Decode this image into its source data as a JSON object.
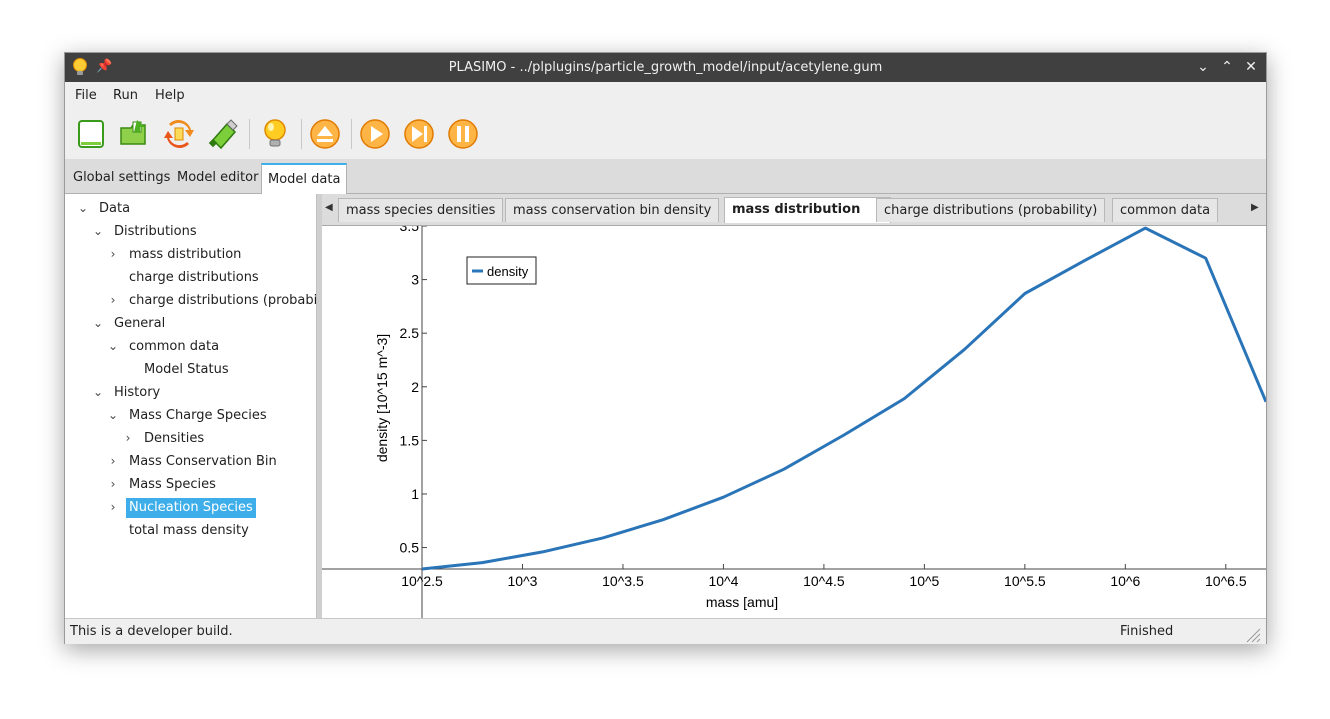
{
  "window": {
    "title": "PLASIMO - ../plplugins/particle_growth_model/input/acetylene.gum",
    "buttons": [
      "minimize",
      "maximize",
      "close"
    ]
  },
  "menu": {
    "items": [
      "File",
      "Run",
      "Help"
    ]
  },
  "toolbar": {
    "icons": [
      "new-file-icon",
      "open-folder-icon",
      "reload-icon",
      "usb-drive-icon",
      "lightbulb-icon",
      "eject-icon",
      "play-icon",
      "step-icon",
      "pause-icon"
    ]
  },
  "main_tabs": [
    "Global settings",
    "Model editor",
    "Model data"
  ],
  "main_tab_active": "Model data",
  "tree": {
    "nodes": [
      {
        "label": "Data",
        "level": 0,
        "expander": "open"
      },
      {
        "label": "Distributions",
        "level": 1,
        "expander": "open"
      },
      {
        "label": "mass distribution",
        "level": 2,
        "expander": "closed"
      },
      {
        "label": "charge distributions",
        "level": 2,
        "expander": "none"
      },
      {
        "label": "charge distributions (probabilit",
        "level": 2,
        "expander": "closed"
      },
      {
        "label": "General",
        "level": 1,
        "expander": "open"
      },
      {
        "label": "common data",
        "level": 2,
        "expander": "open"
      },
      {
        "label": "Model Status",
        "level": 3,
        "expander": "none"
      },
      {
        "label": "History",
        "level": 1,
        "expander": "open"
      },
      {
        "label": "Mass Charge Species",
        "level": 2,
        "expander": "open"
      },
      {
        "label": "Densities",
        "level": 3,
        "expander": "closed"
      },
      {
        "label": "Mass Conservation Bin",
        "level": 2,
        "expander": "closed"
      },
      {
        "label": "Mass Species",
        "level": 2,
        "expander": "closed"
      },
      {
        "label": "Nucleation Species",
        "level": 2,
        "expander": "closed",
        "selected": true
      },
      {
        "label": "total mass density",
        "level": 2,
        "expander": "none"
      }
    ]
  },
  "data_tabs": [
    {
      "label": "mass species densities"
    },
    {
      "label": "mass conservation bin density"
    },
    {
      "label": "mass distribution",
      "active": true,
      "closable": true
    },
    {
      "label": "charge distributions (probability)"
    },
    {
      "label": "common data"
    }
  ],
  "chart_data": {
    "type": "line",
    "xlabel": "mass [amu]",
    "ylabel": "density [10^15 m^-3]",
    "x_tick_labels": [
      "10^2.5",
      "10^3",
      "10^3.5",
      "10^4",
      "10^4.5",
      "10^5",
      "10^5.5",
      "10^6",
      "10^6.5"
    ],
    "x_tick_exponents": [
      2.5,
      3,
      3.5,
      4,
      4.5,
      5,
      5.5,
      6,
      6.5
    ],
    "y_tick_labels": [
      "0.5",
      "1",
      "1.5",
      "2",
      "2.5",
      "3",
      "3.5"
    ],
    "y_tick_values": [
      0.5,
      1,
      1.5,
      2,
      2.5,
      3,
      3.5
    ],
    "x_scale": "log10",
    "xlim_exponent": [
      2.5,
      6.7
    ],
    "ylim": [
      0.3,
      3.5
    ],
    "legend_placement": "top-left",
    "grid": false,
    "series": [
      {
        "name": "density",
        "color": "#2a74b8",
        "x_exponent": [
          2.5,
          2.8,
          3.1,
          3.4,
          3.7,
          4.0,
          4.3,
          4.6,
          4.9,
          5.2,
          5.5,
          5.8,
          6.1,
          6.4,
          6.7
        ],
        "y": [
          0.3,
          0.36,
          0.46,
          0.59,
          0.76,
          0.97,
          1.23,
          1.55,
          1.89,
          2.35,
          2.87,
          3.18,
          3.48,
          3.2,
          1.86
        ]
      }
    ]
  },
  "status": {
    "left": "This is a developer build.",
    "right": "Finished"
  }
}
